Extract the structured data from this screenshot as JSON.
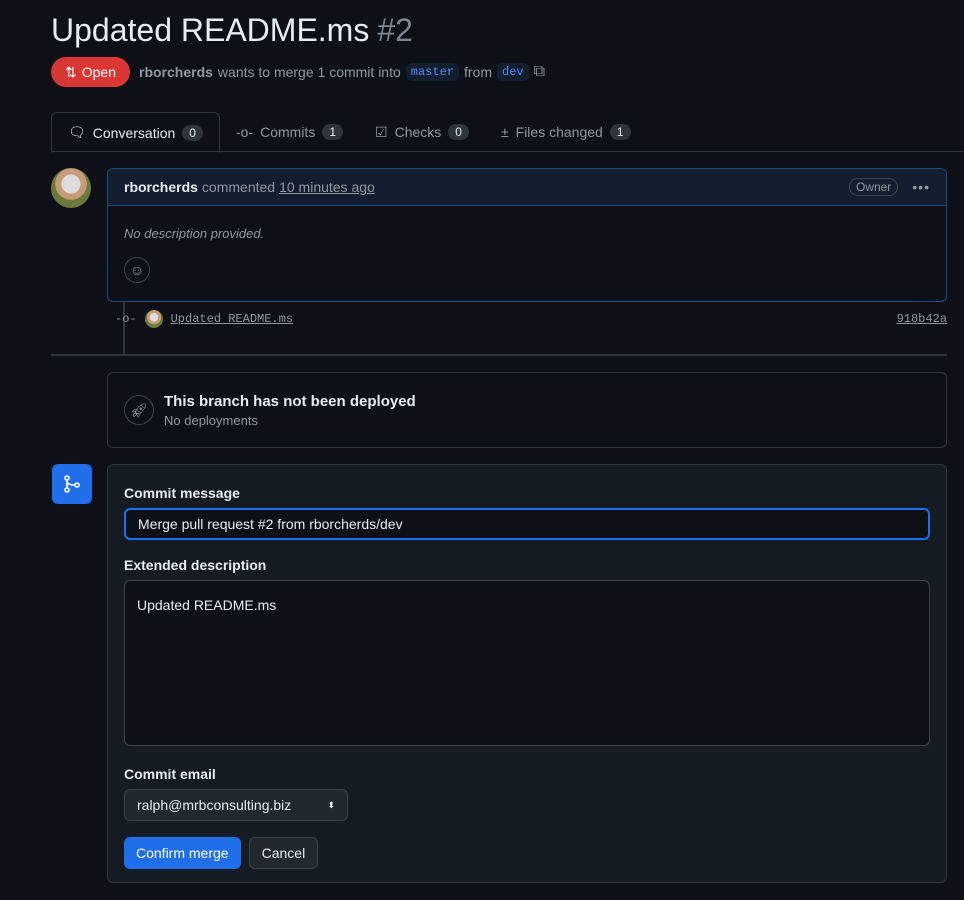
{
  "pr": {
    "title": "Updated README.ms",
    "number": "#2",
    "state": "Open",
    "author": "rborcherds",
    "merge_text": "wants to merge 1 commit into",
    "base": "master",
    "from": "from",
    "head": "dev"
  },
  "tabs": [
    {
      "label": "Conversation",
      "count": "0"
    },
    {
      "label": "Commits",
      "count": "1"
    },
    {
      "label": "Checks",
      "count": "0"
    },
    {
      "label": "Files changed",
      "count": "1"
    }
  ],
  "comment": {
    "author": "rborcherds",
    "action": "commented",
    "time": "10 minutes ago",
    "role": "Owner",
    "body": "No description provided."
  },
  "commit": {
    "message": "Updated README.ms",
    "sha": "918b42a"
  },
  "deploy": {
    "title": "This branch has not been deployed",
    "subtitle": "No deployments"
  },
  "merge_form": {
    "commit_message_label": "Commit message",
    "commit_message": "Merge pull request #2 from rborcherds/dev",
    "extended_label": "Extended description",
    "extended": "Updated README.ms",
    "email_label": "Commit email",
    "email": "ralph@mrbconsulting.biz",
    "confirm": "Confirm merge",
    "cancel": "Cancel"
  },
  "colors": {
    "open": "#da3633",
    "primary": "#1f6feb",
    "bg": "#0d1117"
  }
}
